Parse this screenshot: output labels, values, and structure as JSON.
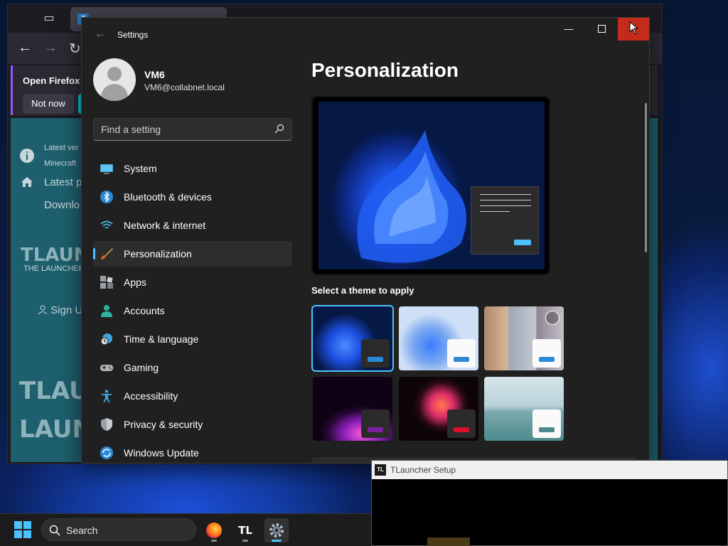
{
  "firefox": {
    "notification_text": "Open Firefox ev",
    "not_now_label": "Not now",
    "page": {
      "latest_ver": "Latest ver",
      "minecraft": "Minecraft",
      "latest_p": "Latest p",
      "download": "Downlo",
      "brand": "TLAUNC",
      "tagline": "THE LAUNCHER",
      "sign_in": "Sign U",
      "big_1": "TLAU",
      "big_2": "LAUN"
    }
  },
  "settings": {
    "title": "Settings",
    "profile": {
      "name": "VM6",
      "email": "VM6@collabnet.local"
    },
    "search": {
      "placeholder": "Find a setting"
    },
    "nav": [
      {
        "label": "System",
        "icon": "monitor-icon"
      },
      {
        "label": "Bluetooth & devices",
        "icon": "bluetooth-icon"
      },
      {
        "label": "Network & internet",
        "icon": "wifi-icon"
      },
      {
        "label": "Personalization",
        "icon": "paintbrush-icon"
      },
      {
        "label": "Apps",
        "icon": "apps-icon"
      },
      {
        "label": "Accounts",
        "icon": "person-icon"
      },
      {
        "label": "Time & language",
        "icon": "clock-globe-icon"
      },
      {
        "label": "Gaming",
        "icon": "gamepad-icon"
      },
      {
        "label": "Accessibility",
        "icon": "accessibility-icon"
      },
      {
        "label": "Privacy & security",
        "icon": "shield-icon"
      },
      {
        "label": "Windows Update",
        "icon": "update-icon"
      }
    ],
    "active_nav": "Personalization",
    "content": {
      "title": "Personalization",
      "themes_label": "Select a theme to apply",
      "accent_color": "#4cc2ff"
    }
  },
  "tlauncher_setup": {
    "title": "TLauncher Setup",
    "icon_text": "TL"
  },
  "taskbar": {
    "search_label": "Search",
    "tl_label": "TL"
  }
}
